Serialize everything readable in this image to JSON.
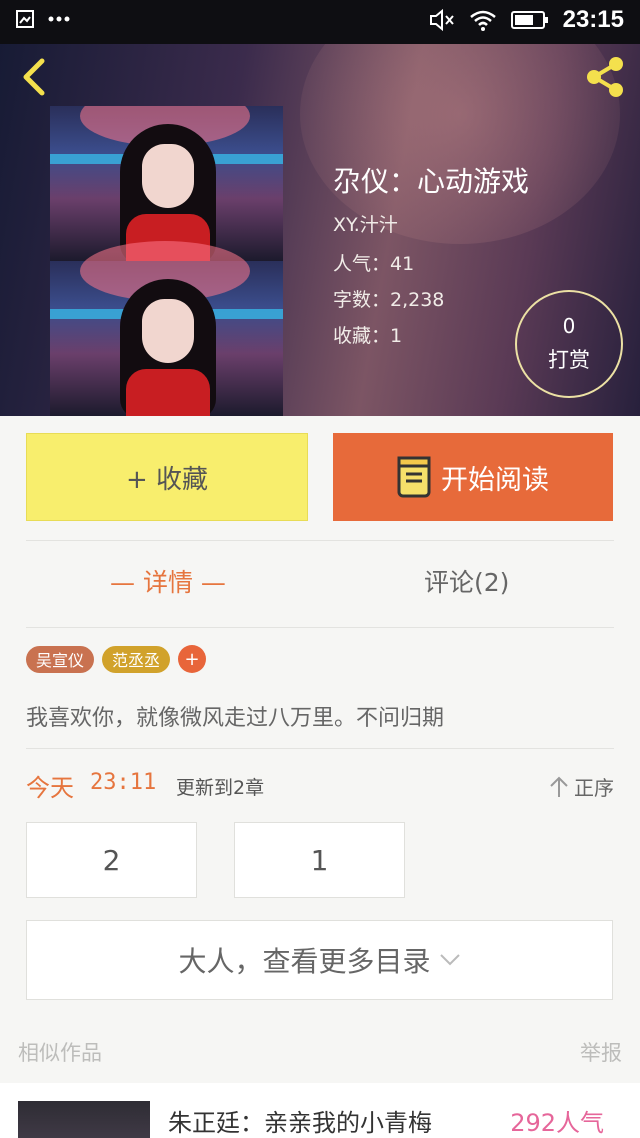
{
  "status_bar": {
    "time": "23:15",
    "icons": [
      "gallery-icon",
      "more-dots-icon",
      "mute-icon",
      "wifi-icon",
      "battery-icon"
    ]
  },
  "book": {
    "title": "尕仪：心动游戏",
    "author": "XY.汁汁",
    "popularity": "人气：41",
    "word_count": "字数：2,238",
    "favorites": "收藏：1",
    "reward_count": "0",
    "reward_label": "打赏"
  },
  "actions": {
    "favorite": "+ 收藏",
    "start_reading": "开始阅读"
  },
  "tabs": {
    "details": "— 详情 —",
    "comments": "评论(2)"
  },
  "tags": [
    "吴宣仪",
    "范丞丞",
    "+"
  ],
  "summary": "我喜欢你，就像微风走过八万里。不问归期",
  "update": {
    "day": "今天",
    "time": "23:11",
    "text": "更新到2章",
    "order": "正序"
  },
  "chapters": [
    "2",
    "1"
  ],
  "more_chapters": "大人，查看更多目录",
  "similar_section": {
    "label": "相似作品",
    "report": "举报",
    "items": [
      {
        "title": "朱正廷：亲亲我的小青梅",
        "popularity": "292人气"
      }
    ]
  },
  "colors": {
    "accent_orange": "#e76a3a",
    "favorite_yellow": "#f8ee6d",
    "icon_yellow": "#f4e04d",
    "popularity_pink": "#e6669a"
  }
}
